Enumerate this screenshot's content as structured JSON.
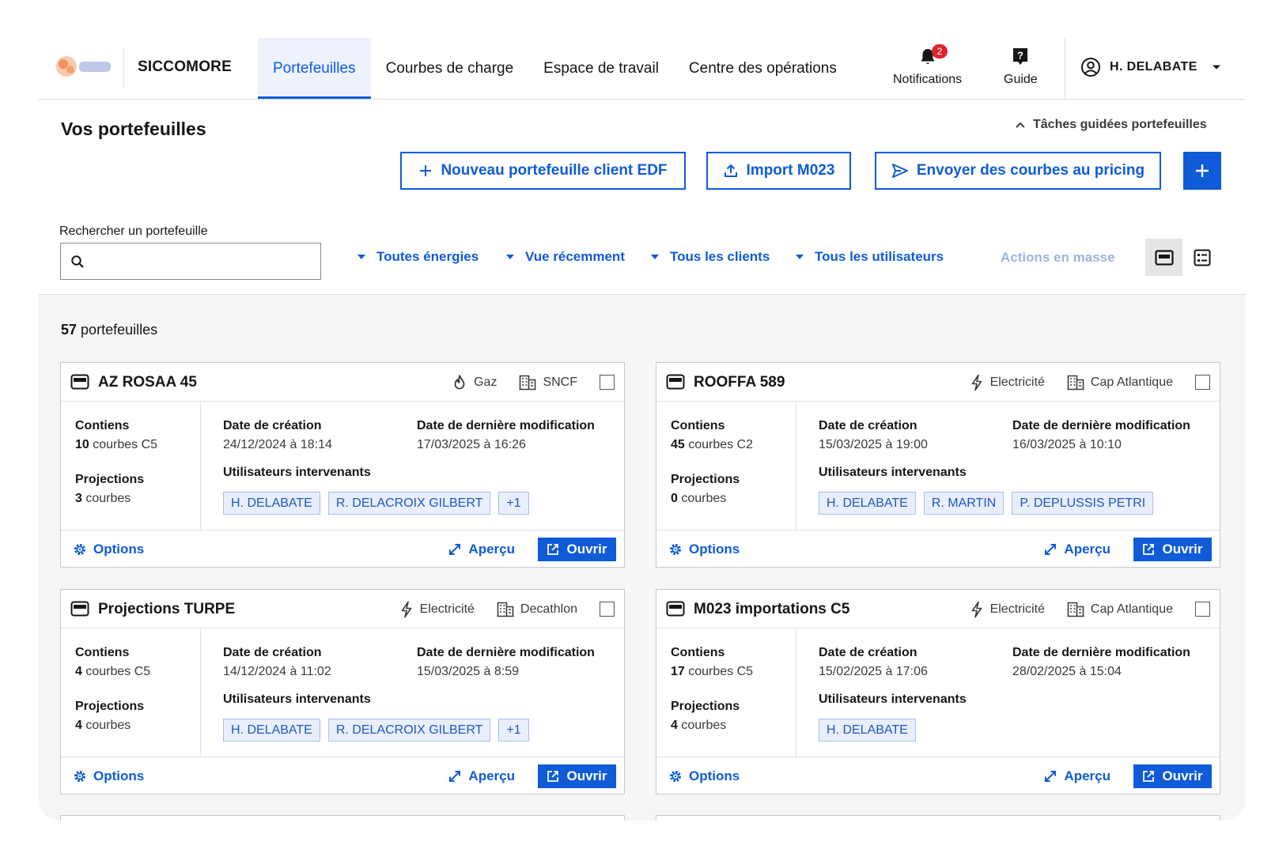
{
  "header": {
    "app_name": "SICCOMORE",
    "tabs": [
      {
        "label": "Portefeuilles",
        "active": true
      },
      {
        "label": "Courbes de charge"
      },
      {
        "label": "Espace de travail"
      },
      {
        "label": "Centre des opérations"
      }
    ],
    "notifications": {
      "label": "Notifications",
      "count": "2",
      "icon": "bell-icon"
    },
    "guide": {
      "label": "Guide",
      "icon": "help-icon"
    },
    "user": {
      "name": "H. DELABATE",
      "icon": "user-circle-icon"
    }
  },
  "page": {
    "title": "Vos portefeuilles",
    "guided_tasks": "Tâches guidées portefeuilles",
    "actions": {
      "new_portfolio": "Nouveau portefeuille client EDF",
      "import": "Import M023",
      "send_pricing": "Envoyer des courbes au pricing"
    }
  },
  "filters": {
    "search_label": "Rechercher un portefeuille",
    "search_value": "",
    "energy": "Toutes énergies",
    "recent": "Vue récemment",
    "clients": "Tous les clients",
    "users": "Tous les utilisateurs",
    "bulk_actions": "Actions en masse"
  },
  "results": {
    "count": "57",
    "count_label": "portefeuilles"
  },
  "labels": {
    "contains": "Contiens",
    "projections": "Projections",
    "created": "Date de création",
    "modified": "Date de dernière modification",
    "users": "Utilisateurs intervenants",
    "options": "Options",
    "preview": "Aperçu",
    "open": "Ouvrir"
  },
  "cards": [
    {
      "title": "AZ ROSAA 45",
      "energy": "Gaz",
      "energy_icon": "flame-icon",
      "client": "SNCF",
      "curves_count": "10",
      "curves_label": "courbes C5",
      "projections_count": "3",
      "projections_label": "courbes",
      "created": "24/12/2024 à 18:14",
      "modified": "17/03/2025 à 16:26",
      "users": [
        "H. DELABATE",
        "R. DELACROIX GILBERT",
        "+1"
      ]
    },
    {
      "title": "ROOFFA 589",
      "energy": "Electricité",
      "energy_icon": "bolt-icon",
      "client": "Cap Atlantique",
      "curves_count": "45",
      "curves_label": "courbes C2",
      "projections_count": "0",
      "projections_label": "courbes",
      "created": "15/03/2025 à 19:00",
      "modified": "16/03/2025 à 10:10",
      "users": [
        "H. DELABATE",
        "R. MARTIN",
        "P. DEPLUSSIS PETRI"
      ]
    },
    {
      "title": "Projections TURPE",
      "energy": "Electricité",
      "energy_icon": "bolt-icon",
      "client": "Decathlon",
      "curves_count": "4",
      "curves_label": "courbes C5",
      "projections_count": "4",
      "projections_label": "courbes",
      "created": "14/12/2024 à 11:02",
      "modified": "15/03/2025 à 8:59",
      "users": [
        "H. DELABATE",
        "R. DELACROIX GILBERT",
        "+1"
      ]
    },
    {
      "title": "M023 importations C5",
      "energy": "Electricité",
      "energy_icon": "bolt-icon",
      "client": "Cap Atlantique",
      "curves_count": "17",
      "curves_label": "courbes C5",
      "projections_count": "4",
      "projections_label": "courbes",
      "created": "15/02/2025 à 17:06",
      "modified": "28/02/2025 à 15:04",
      "users": [
        "H. DELABATE"
      ]
    }
  ],
  "colors": {
    "primary": "#0f5bd8",
    "chip_bg": "#e8eefc",
    "badge": "#d8262c",
    "content_bg": "#f6f6f6"
  }
}
